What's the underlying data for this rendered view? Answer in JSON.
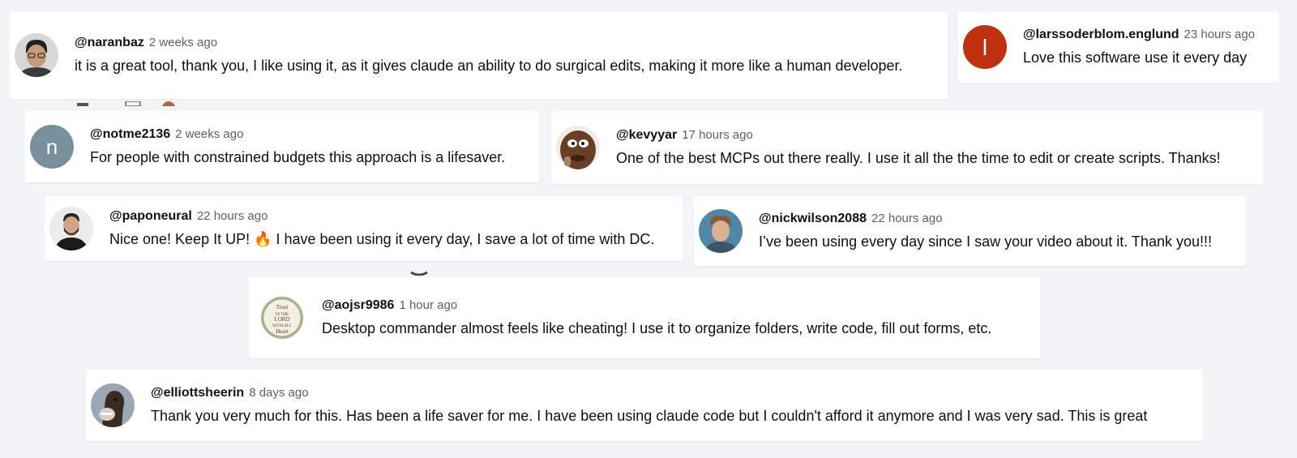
{
  "comments": [
    {
      "handle": "@naranbaz",
      "time": "2 weeks ago",
      "text": "it is a great tool, thank you, I like using it, as it gives claude an ability to do surgical edits, making it more like a human developer.",
      "avatar": "photo-man-glasses"
    },
    {
      "handle": "@larssoderblom.englund",
      "time": "23 hours ago",
      "text": "Love this software use it every day",
      "avatar": "letter",
      "avatar_letter": "l",
      "avatar_color": "#c0320f"
    },
    {
      "handle": "@notme2136",
      "time": "2 weeks ago",
      "text": "For people with constrained budgets this approach is a lifesaver.",
      "avatar": "letter",
      "avatar_letter": "n",
      "avatar_color": "#78909c"
    },
    {
      "handle": "@kevyyar",
      "time": "17 hours ago",
      "text": "One of the best MCPs out there really. I use it all the the time to edit or create scripts. Thanks!",
      "avatar": "photo-face-meme"
    },
    {
      "handle": "@paponeural",
      "time": "22 hours ago",
      "text": "Nice one! Keep It UP! 🔥  I have been using it every day, I save a lot of time with DC.",
      "avatar": "photo-man-beard"
    },
    {
      "handle": "@nickwilson2088",
      "time": "22 hours ago",
      "text": "I’ve been using every day since I saw your video about it. Thank you!!!",
      "avatar": "photo-man-curly"
    },
    {
      "handle": "@aojsr9986",
      "time": "1 hour ago",
      "text": "Desktop commander almost feels like cheating! I use it to organize folders, write code, fill out forms, etc.",
      "avatar": "sign-trust-lord"
    },
    {
      "handle": "@elliottsheerin",
      "time": "8 days ago",
      "text": "Thank you very much for this. Has been a life saver for me. I have been using claude code but I couldn't afford it anymore and I was very sad. This is great",
      "avatar": "photo-horse"
    }
  ],
  "colors": {
    "background": "#f3f4f7",
    "card": "#ffffff",
    "timestamp": "#606060"
  }
}
